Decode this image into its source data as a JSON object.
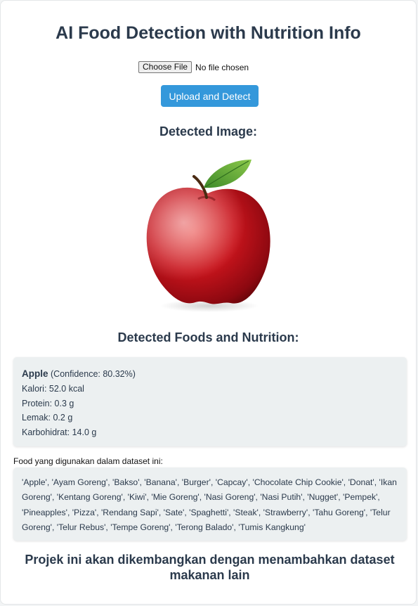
{
  "page": {
    "title": "AI Food Detection with Nutrition Info"
  },
  "upload": {
    "choose_file_label": "Choose File",
    "file_status": "No file chosen",
    "submit_label": "Upload and Detect"
  },
  "detected_image": {
    "heading": "Detected Image:",
    "subject": "red apple with green leaf"
  },
  "results": {
    "heading": "Detected Foods and Nutrition:",
    "items": [
      {
        "name": "Apple",
        "confidence": "(Confidence: 80.32%)",
        "kalori": "Kalori: 52.0 kcal",
        "protein": "Protein: 0.3 g",
        "lemak": "Lemak: 0.2 g",
        "karbohidrat": "Karbohidrat: 14.0 g"
      }
    ]
  },
  "dataset": {
    "label": "Food yang digunakan dalam dataset ini:",
    "foods_text": "'Apple', 'Ayam Goreng', 'Bakso', 'Banana', 'Burger', 'Capcay', 'Chocolate Chip Cookie', 'Donat', 'Ikan Goreng', 'Kentang Goreng', 'Kiwi', 'Mie Goreng', 'Nasi Goreng', 'Nasi Putih', 'Nugget', 'Pempek', 'Pineapples', 'Pizza', 'Rendang Sapi', 'Sate', 'Spaghetti', 'Steak', 'Strawberry', 'Tahu Goreng', 'Telur Goreng', 'Telur Rebus', 'Tempe Goreng', 'Terong Balado', 'Tumis Kangkung'"
  },
  "footer": {
    "note": "Projek ini akan dikembangkan dengan menambahkan dataset makanan lain"
  },
  "colors": {
    "accent": "#3498db",
    "heading": "#2b3a4c",
    "card_bg": "#ecf0f1"
  }
}
